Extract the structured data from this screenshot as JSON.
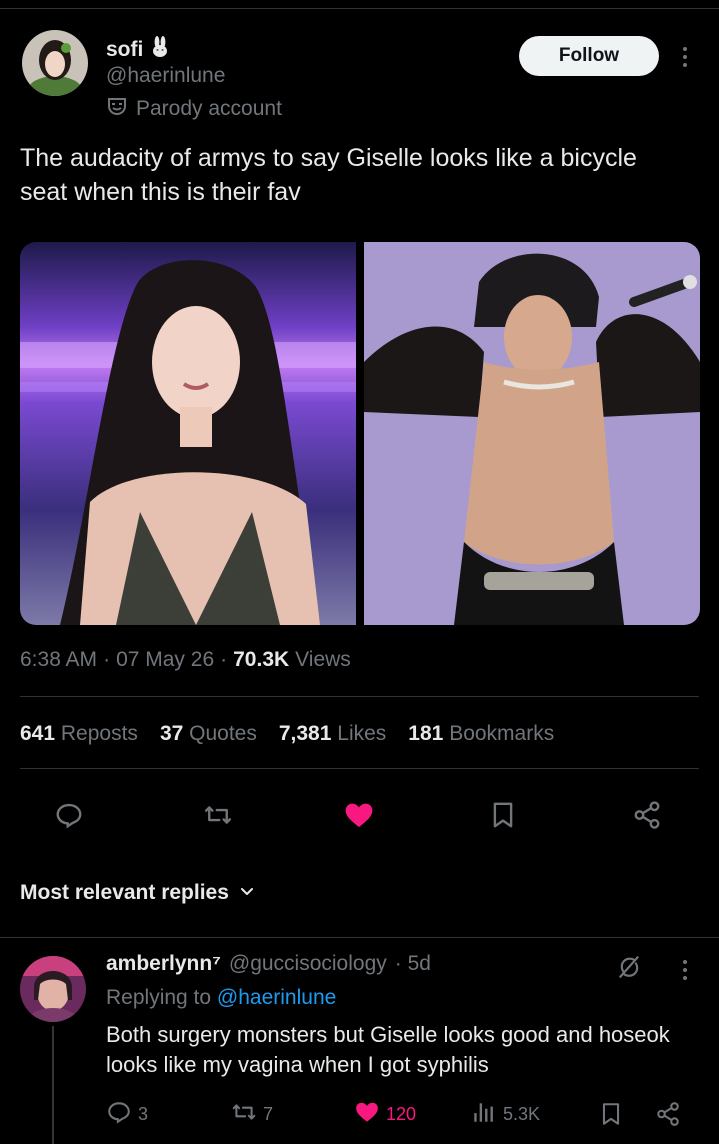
{
  "post": {
    "author_name": "sofi",
    "author_handle": "@haerinlune",
    "parody_label": "Parody account",
    "follow_label": "Follow",
    "text": "The audacity of armys to say Giselle looks like a bicycle seat when this is their fav",
    "time": "6:38 AM",
    "date": "07 May 26",
    "views_count": "70.3K",
    "views_label": "Views",
    "separator": "·"
  },
  "stats": {
    "reposts_count": "641",
    "reposts_label": "Reposts",
    "quotes_count": "37",
    "quotes_label": "Quotes",
    "likes_count": "7,381",
    "likes_label": "Likes",
    "bookmarks_count": "181",
    "bookmarks_label": "Bookmarks"
  },
  "replies_header": "Most relevant replies",
  "reply": {
    "author_name": "amberlynn⁷",
    "author_handle": "@guccisociology",
    "age": "· 5d",
    "replying_prefix": "Replying to",
    "replying_handle": "@haerinlune",
    "text": "Both surgery monsters but Giselle looks good and hoseok looks like my vagina when I got syphilis",
    "replies": "3",
    "reposts": "7",
    "likes": "120",
    "views": "5.3K"
  },
  "colors": {
    "background": "#000000",
    "text": "#e7e9ea",
    "muted": "#71767b",
    "accent": "#1d9bf0",
    "like": "#f91880",
    "divider": "#2f3336"
  },
  "icons": [
    "rabbit-emoji-icon",
    "parody-mask-icon",
    "more-icon",
    "reply-icon",
    "repost-icon",
    "like-icon",
    "bookmark-icon",
    "share-icon",
    "chevron-down-icon",
    "grok-icon",
    "views-icon"
  ]
}
